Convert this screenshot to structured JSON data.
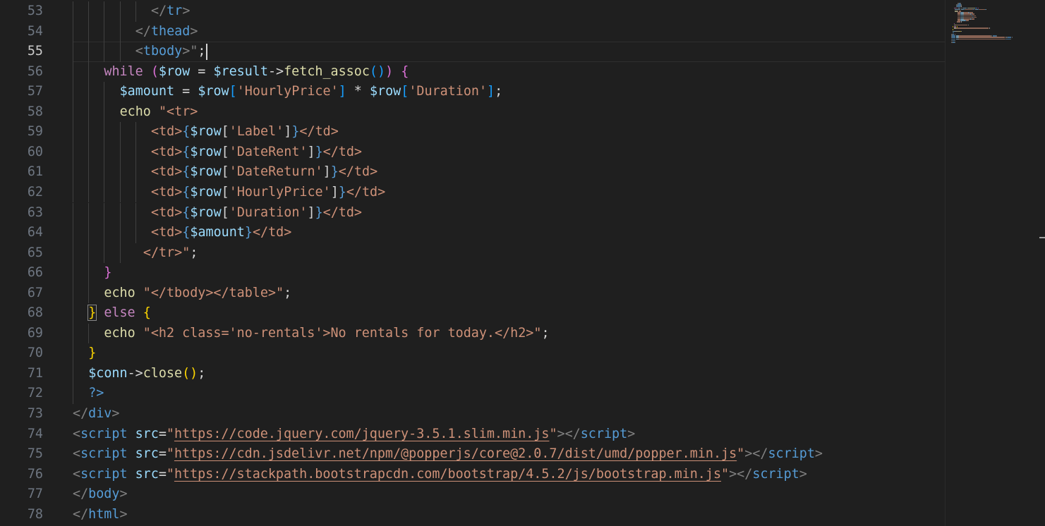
{
  "editor": {
    "language": "php",
    "active_line": "55",
    "lines": [
      {
        "number": "53",
        "indent": 10,
        "tokens": [
          {
            "t": "</",
            "c": "t-tag"
          },
          {
            "t": "tr",
            "c": "t-tagname"
          },
          {
            "t": ">",
            "c": "t-tag"
          }
        ]
      },
      {
        "number": "54",
        "indent": 8,
        "tokens": [
          {
            "t": "</",
            "c": "t-tag"
          },
          {
            "t": "thead",
            "c": "t-tagname"
          },
          {
            "t": ">",
            "c": "t-tag"
          }
        ]
      },
      {
        "number": "55",
        "indent": 8,
        "tokens": [
          {
            "t": "<",
            "c": "t-tag"
          },
          {
            "t": "tbody",
            "c": "t-tagname"
          },
          {
            "t": ">\"",
            "c": "t-tag"
          },
          {
            "t": ";",
            "c": "t-op"
          }
        ]
      },
      {
        "number": "56",
        "indent": 4,
        "tokens": [
          {
            "t": "while",
            "c": "t-kw"
          },
          {
            "t": " ",
            "c": "t-op"
          },
          {
            "t": "(",
            "c": "t-br2"
          },
          {
            "t": "$row",
            "c": "t-var"
          },
          {
            "t": " = ",
            "c": "t-op"
          },
          {
            "t": "$result",
            "c": "t-var"
          },
          {
            "t": "->",
            "c": "t-op"
          },
          {
            "t": "fetch_assoc",
            "c": "t-fn"
          },
          {
            "t": "()",
            "c": "t-br3"
          },
          {
            "t": ")",
            "c": "t-br2"
          },
          {
            "t": " ",
            "c": "t-op"
          },
          {
            "t": "{",
            "c": "t-br2"
          }
        ]
      },
      {
        "number": "57",
        "indent": 6,
        "tokens": [
          {
            "t": "$amount",
            "c": "t-var"
          },
          {
            "t": " = ",
            "c": "t-op"
          },
          {
            "t": "$row",
            "c": "t-var"
          },
          {
            "t": "[",
            "c": "t-br3"
          },
          {
            "t": "'HourlyPrice'",
            "c": "t-str"
          },
          {
            "t": "]",
            "c": "t-br3"
          },
          {
            "t": " * ",
            "c": "t-op"
          },
          {
            "t": "$row",
            "c": "t-var"
          },
          {
            "t": "[",
            "c": "t-br3"
          },
          {
            "t": "'Duration'",
            "c": "t-str"
          },
          {
            "t": "]",
            "c": "t-br3"
          },
          {
            "t": ";",
            "c": "t-op"
          }
        ]
      },
      {
        "number": "58",
        "indent": 6,
        "tokens": [
          {
            "t": "echo",
            "c": "t-echo"
          },
          {
            "t": " \"",
            "c": "t-str"
          },
          {
            "t": "<tr>",
            "c": "t-str"
          }
        ]
      },
      {
        "number": "59",
        "indent": 10,
        "tokens": [
          {
            "t": "<td>",
            "c": "t-str"
          },
          {
            "t": "{",
            "c": "t-php"
          },
          {
            "t": "$row",
            "c": "t-var"
          },
          {
            "t": "[",
            "c": "t-op"
          },
          {
            "t": "'Label'",
            "c": "t-str"
          },
          {
            "t": "]",
            "c": "t-op"
          },
          {
            "t": "}",
            "c": "t-php"
          },
          {
            "t": "</td>",
            "c": "t-str"
          }
        ]
      },
      {
        "number": "60",
        "indent": 10,
        "tokens": [
          {
            "t": "<td>",
            "c": "t-str"
          },
          {
            "t": "{",
            "c": "t-php"
          },
          {
            "t": "$row",
            "c": "t-var"
          },
          {
            "t": "[",
            "c": "t-op"
          },
          {
            "t": "'DateRent'",
            "c": "t-str"
          },
          {
            "t": "]",
            "c": "t-op"
          },
          {
            "t": "}",
            "c": "t-php"
          },
          {
            "t": "</td>",
            "c": "t-str"
          }
        ]
      },
      {
        "number": "61",
        "indent": 10,
        "tokens": [
          {
            "t": "<td>",
            "c": "t-str"
          },
          {
            "t": "{",
            "c": "t-php"
          },
          {
            "t": "$row",
            "c": "t-var"
          },
          {
            "t": "[",
            "c": "t-op"
          },
          {
            "t": "'DateReturn'",
            "c": "t-str"
          },
          {
            "t": "]",
            "c": "t-op"
          },
          {
            "t": "}",
            "c": "t-php"
          },
          {
            "t": "</td>",
            "c": "t-str"
          }
        ]
      },
      {
        "number": "62",
        "indent": 10,
        "tokens": [
          {
            "t": "<td>",
            "c": "t-str"
          },
          {
            "t": "{",
            "c": "t-php"
          },
          {
            "t": "$row",
            "c": "t-var"
          },
          {
            "t": "[",
            "c": "t-op"
          },
          {
            "t": "'HourlyPrice'",
            "c": "t-str"
          },
          {
            "t": "]",
            "c": "t-op"
          },
          {
            "t": "}",
            "c": "t-php"
          },
          {
            "t": "</td>",
            "c": "t-str"
          }
        ]
      },
      {
        "number": "63",
        "indent": 10,
        "tokens": [
          {
            "t": "<td>",
            "c": "t-str"
          },
          {
            "t": "{",
            "c": "t-php"
          },
          {
            "t": "$row",
            "c": "t-var"
          },
          {
            "t": "[",
            "c": "t-op"
          },
          {
            "t": "'Duration'",
            "c": "t-str"
          },
          {
            "t": "]",
            "c": "t-op"
          },
          {
            "t": "}",
            "c": "t-php"
          },
          {
            "t": "</td>",
            "c": "t-str"
          }
        ]
      },
      {
        "number": "64",
        "indent": 10,
        "tokens": [
          {
            "t": "<td>",
            "c": "t-str"
          },
          {
            "t": "{",
            "c": "t-php"
          },
          {
            "t": "$amount",
            "c": "t-var"
          },
          {
            "t": "}",
            "c": "t-php"
          },
          {
            "t": "</td>",
            "c": "t-str"
          }
        ]
      },
      {
        "number": "65",
        "indent": 9,
        "tokens": [
          {
            "t": "</tr>\"",
            "c": "t-str"
          },
          {
            "t": ";",
            "c": "t-op"
          }
        ]
      },
      {
        "number": "66",
        "indent": 4,
        "tokens": [
          {
            "t": "}",
            "c": "t-br2"
          }
        ]
      },
      {
        "number": "67",
        "indent": 4,
        "tokens": [
          {
            "t": "echo",
            "c": "t-echo"
          },
          {
            "t": " \"</tbody></table>\"",
            "c": "t-str"
          },
          {
            "t": ";",
            "c": "t-op"
          }
        ]
      },
      {
        "number": "68",
        "indent": 2,
        "tokens": [
          {
            "t": "}",
            "c": "t-br1 bracket-match"
          },
          {
            "t": " ",
            "c": "t-op"
          },
          {
            "t": "else",
            "c": "t-kw"
          },
          {
            "t": " ",
            "c": "t-op"
          },
          {
            "t": "{",
            "c": "t-br1"
          }
        ]
      },
      {
        "number": "69",
        "indent": 4,
        "tokens": [
          {
            "t": "echo",
            "c": "t-echo"
          },
          {
            "t": " \"<h2 class='no-rentals'>No rentals for today.</h2>\"",
            "c": "t-str"
          },
          {
            "t": ";",
            "c": "t-op"
          }
        ]
      },
      {
        "number": "70",
        "indent": 2,
        "tokens": [
          {
            "t": "}",
            "c": "t-br1"
          }
        ]
      },
      {
        "number": "71",
        "indent": 2,
        "tokens": [
          {
            "t": "$conn",
            "c": "t-var"
          },
          {
            "t": "->",
            "c": "t-op"
          },
          {
            "t": "close",
            "c": "t-fn"
          },
          {
            "t": "()",
            "c": "t-br1"
          },
          {
            "t": ";",
            "c": "t-op"
          }
        ]
      },
      {
        "number": "72",
        "indent": 2,
        "tokens": [
          {
            "t": "?>",
            "c": "t-php"
          }
        ]
      },
      {
        "number": "73",
        "indent": 0,
        "tokens": [
          {
            "t": "</",
            "c": "t-tag"
          },
          {
            "t": "div",
            "c": "t-tagname"
          },
          {
            "t": ">",
            "c": "t-tag"
          }
        ]
      },
      {
        "number": "74",
        "indent": 0,
        "tokens": [
          {
            "t": "<",
            "c": "t-tag"
          },
          {
            "t": "script",
            "c": "t-tagname"
          },
          {
            "t": " ",
            "c": "t-op"
          },
          {
            "t": "src",
            "c": "t-attr"
          },
          {
            "t": "=",
            "c": "t-op"
          },
          {
            "t": "\"",
            "c": "t-str"
          },
          {
            "t": "https://code.jquery.com/jquery-3.5.1.slim.min.js",
            "c": "t-link"
          },
          {
            "t": "\"",
            "c": "t-str"
          },
          {
            "t": "></",
            "c": "t-tag"
          },
          {
            "t": "script",
            "c": "t-tagname"
          },
          {
            "t": ">",
            "c": "t-tag"
          }
        ]
      },
      {
        "number": "75",
        "indent": 0,
        "tokens": [
          {
            "t": "<",
            "c": "t-tag"
          },
          {
            "t": "script",
            "c": "t-tagname"
          },
          {
            "t": " ",
            "c": "t-op"
          },
          {
            "t": "src",
            "c": "t-attr"
          },
          {
            "t": "=",
            "c": "t-op"
          },
          {
            "t": "\"",
            "c": "t-str"
          },
          {
            "t": "https://cdn.jsdelivr.net/npm/@popperjs/core@2.0.7/dist/umd/popper.min.js",
            "c": "t-link"
          },
          {
            "t": "\"",
            "c": "t-str"
          },
          {
            "t": "></",
            "c": "t-tag"
          },
          {
            "t": "script",
            "c": "t-tagname"
          },
          {
            "t": ">",
            "c": "t-tag"
          }
        ]
      },
      {
        "number": "76",
        "indent": 0,
        "tokens": [
          {
            "t": "<",
            "c": "t-tag"
          },
          {
            "t": "script",
            "c": "t-tagname"
          },
          {
            "t": " ",
            "c": "t-op"
          },
          {
            "t": "src",
            "c": "t-attr"
          },
          {
            "t": "=",
            "c": "t-op"
          },
          {
            "t": "\"",
            "c": "t-str"
          },
          {
            "t": "https://stackpath.bootstrapcdn.com/bootstrap/4.5.2/js/bootstrap.min.js",
            "c": "t-link"
          },
          {
            "t": "\"",
            "c": "t-str"
          },
          {
            "t": "></",
            "c": "t-tag"
          },
          {
            "t": "script",
            "c": "t-tagname"
          },
          {
            "t": ">",
            "c": "t-tag"
          }
        ]
      },
      {
        "number": "77",
        "indent": 0,
        "tokens": [
          {
            "t": "</",
            "c": "t-tag"
          },
          {
            "t": "body",
            "c": "t-tagname"
          },
          {
            "t": ">",
            "c": "t-tag"
          }
        ]
      },
      {
        "number": "78",
        "indent": 0,
        "tokens": [
          {
            "t": "</",
            "c": "t-tag"
          },
          {
            "t": "html",
            "c": "t-tagname"
          },
          {
            "t": ">",
            "c": "t-tag"
          }
        ]
      }
    ]
  },
  "colors": {
    "background": "#1f1f1f",
    "line_number": "#6e7681",
    "line_number_active": "#cccccc",
    "indent_guide": "#404040"
  }
}
